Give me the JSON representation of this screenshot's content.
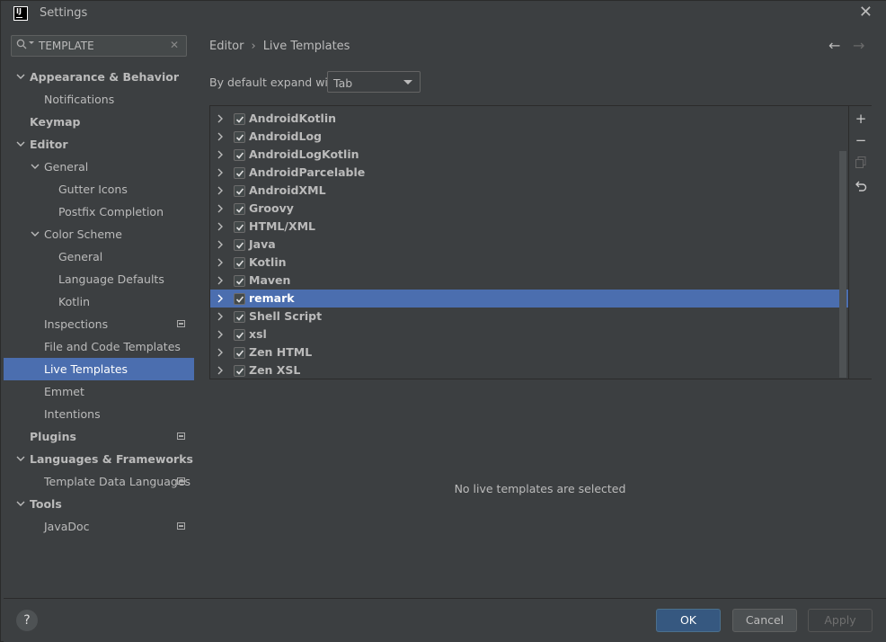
{
  "window": {
    "title": "Settings",
    "logo_text": "IJ"
  },
  "search": {
    "value": "TEMPLATE"
  },
  "sidebar": {
    "items": [
      {
        "label": "Appearance & Behavior",
        "level": 0,
        "expanded": true,
        "bold": true,
        "project_icon": false
      },
      {
        "label": "Notifications",
        "level": 1,
        "expanded": null,
        "bold": false,
        "project_icon": false
      },
      {
        "label": "Keymap",
        "level": 0,
        "expanded": null,
        "bold": true,
        "project_icon": false
      },
      {
        "label": "Editor",
        "level": 0,
        "expanded": true,
        "bold": true,
        "project_icon": false
      },
      {
        "label": "General",
        "level": 1,
        "expanded": true,
        "bold": false,
        "project_icon": false
      },
      {
        "label": "Gutter Icons",
        "level": 2,
        "expanded": null,
        "bold": false,
        "project_icon": false
      },
      {
        "label": "Postfix Completion",
        "level": 2,
        "expanded": null,
        "bold": false,
        "project_icon": false
      },
      {
        "label": "Color Scheme",
        "level": 1,
        "expanded": true,
        "bold": false,
        "project_icon": false
      },
      {
        "label": "General",
        "level": 2,
        "expanded": null,
        "bold": false,
        "project_icon": false
      },
      {
        "label": "Language Defaults",
        "level": 2,
        "expanded": null,
        "bold": false,
        "project_icon": false
      },
      {
        "label": "Kotlin",
        "level": 2,
        "expanded": null,
        "bold": false,
        "project_icon": false
      },
      {
        "label": "Inspections",
        "level": 1,
        "expanded": null,
        "bold": false,
        "project_icon": true
      },
      {
        "label": "File and Code Templates",
        "level": 1,
        "expanded": null,
        "bold": false,
        "project_icon": false
      },
      {
        "label": "Live Templates",
        "level": 1,
        "expanded": null,
        "bold": false,
        "project_icon": false,
        "selected": true
      },
      {
        "label": "Emmet",
        "level": 1,
        "expanded": null,
        "bold": false,
        "project_icon": false
      },
      {
        "label": "Intentions",
        "level": 1,
        "expanded": null,
        "bold": false,
        "project_icon": false
      },
      {
        "label": "Plugins",
        "level": 0,
        "expanded": null,
        "bold": true,
        "project_icon": true
      },
      {
        "label": "Languages & Frameworks",
        "level": 0,
        "expanded": true,
        "bold": true,
        "project_icon": false
      },
      {
        "label": "Template Data Languages",
        "level": 1,
        "expanded": null,
        "bold": false,
        "project_icon": true
      },
      {
        "label": "Tools",
        "level": 0,
        "expanded": true,
        "bold": true,
        "project_icon": false
      },
      {
        "label": "JavaDoc",
        "level": 1,
        "expanded": null,
        "bold": false,
        "project_icon": true
      }
    ]
  },
  "main": {
    "breadcrumb": [
      "Editor",
      "Live Templates"
    ],
    "expand_label": "By default expand with",
    "expand_value": "Tab",
    "template_groups": [
      {
        "label": "AndroidKotlin",
        "checked": true
      },
      {
        "label": "AndroidLog",
        "checked": true
      },
      {
        "label": "AndroidLogKotlin",
        "checked": true
      },
      {
        "label": "AndroidParcelable",
        "checked": true
      },
      {
        "label": "AndroidXML",
        "checked": true
      },
      {
        "label": "Groovy",
        "checked": true
      },
      {
        "label": "HTML/XML",
        "checked": true
      },
      {
        "label": "Java",
        "checked": true
      },
      {
        "label": "Kotlin",
        "checked": true
      },
      {
        "label": "Maven",
        "checked": true
      },
      {
        "label": "remark",
        "checked": true,
        "selected": true
      },
      {
        "label": "Shell Script",
        "checked": true
      },
      {
        "label": "xsl",
        "checked": true
      },
      {
        "label": "Zen HTML",
        "checked": true
      },
      {
        "label": "Zen XSL",
        "checked": true
      }
    ],
    "empty_message": "No live templates are selected"
  },
  "footer": {
    "help": "?",
    "ok": "OK",
    "cancel": "Cancel",
    "apply": "Apply"
  },
  "colors": {
    "accent": "#4b6eaf",
    "ok_button": "#365880",
    "background": "#3c3f41"
  }
}
